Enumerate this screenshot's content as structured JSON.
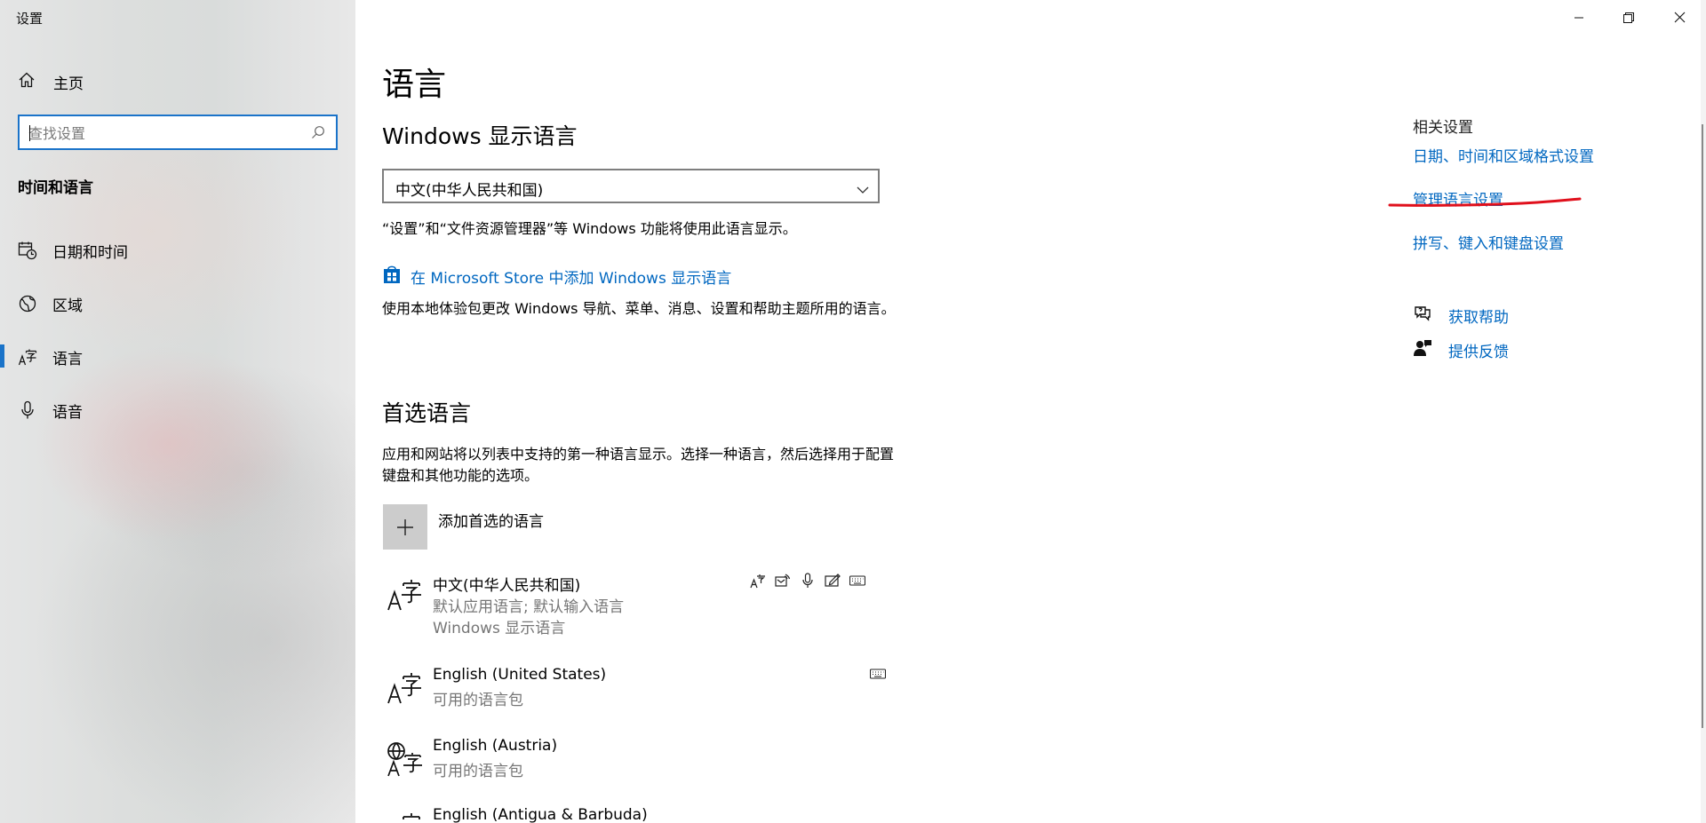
{
  "window": {
    "title": "设置",
    "minimize_icon": "minimize-icon",
    "restore_icon": "restore-icon",
    "close_icon": "close-icon"
  },
  "sidebar": {
    "home_label": "主页",
    "search_placeholder": "查找设置",
    "section_title": "时间和语言",
    "items": [
      {
        "label": "日期和时间",
        "icon": "calendar-clock-icon"
      },
      {
        "label": "区域",
        "icon": "globe-region-icon"
      },
      {
        "label": "语言",
        "icon": "language-icon",
        "active": true
      },
      {
        "label": "语音",
        "icon": "microphone-icon"
      }
    ]
  },
  "main": {
    "title": "语言",
    "display_language": {
      "heading": "Windows 显示语言",
      "selected": "中文(中华人民共和国)",
      "description": "“设置”和“文件资源管理器”等 Windows 功能将使用此语言显示。",
      "store_link": "在 Microsoft Store 中添加 Windows 显示语言",
      "store_description": "使用本地体验包更改 Windows 导航、菜单、消息、设置和帮助主题所用的语言。"
    },
    "preferred": {
      "heading": "首选语言",
      "description": "应用和网站将以列表中支持的第一种语言显示。选择一种语言，然后选择用于配置键盘和其他功能的选项。",
      "add_label": "添加首选的语言",
      "languages": [
        {
          "name": "中文(中华人民共和国)",
          "details": [
            "默认应用语言; 默认输入语言",
            "Windows 显示语言"
          ],
          "features": [
            "display-language-icon",
            "text-to-speech-icon",
            "speech-icon",
            "handwriting-icon",
            "keyboard-icon"
          ]
        },
        {
          "name": "English (United States)",
          "details": [
            "可用的语言包"
          ],
          "features": [
            "keyboard-icon"
          ]
        },
        {
          "name": "English (Austria)",
          "details": [
            "可用的语言包"
          ],
          "features": []
        },
        {
          "name": "English (Antigua & Barbuda)",
          "details": [],
          "features": []
        }
      ]
    }
  },
  "related": {
    "heading": "相关设置",
    "links": [
      "日期、时间和区域格式设置",
      "管理语言设置",
      "拼写、键入和键盘设置"
    ],
    "help": {
      "get_help": "获取帮助",
      "feedback": "提供反馈"
    }
  },
  "colors": {
    "accent": "#0067c0",
    "annotation": "#e0101c"
  }
}
